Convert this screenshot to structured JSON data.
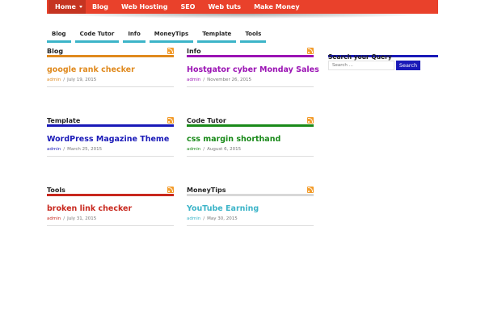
{
  "topnav": {
    "items": [
      {
        "label": "Home",
        "active": true
      },
      {
        "label": "Blog"
      },
      {
        "label": "Web Hosting"
      },
      {
        "label": "SEO"
      },
      {
        "label": "Web tuts"
      },
      {
        "label": "Make Money"
      }
    ]
  },
  "subnav": {
    "items": [
      {
        "label": "Blog"
      },
      {
        "label": "Code Tutor"
      },
      {
        "label": "Info"
      },
      {
        "label": "MoneyTips"
      },
      {
        "label": "Template"
      },
      {
        "label": "Tools"
      }
    ]
  },
  "widgets": [
    {
      "title": "Blog",
      "accent": "#e08a1e",
      "post_title": "google rank checker",
      "post_color": "#e08a1e",
      "author": "admin",
      "date": "July 19, 2015"
    },
    {
      "title": "Info",
      "accent": "#9b14b4",
      "post_title": "Hostgator cyber Monday Sales",
      "post_color": "#9b14b4",
      "author": "admin",
      "date": "November 26, 2015"
    },
    {
      "title": "Template",
      "accent": "#1a1ab8",
      "post_title": "WordPress Magazine Theme",
      "post_color": "#1a1ab8",
      "author": "admin",
      "date": "March 25, 2015"
    },
    {
      "title": "Code Tutor",
      "accent": "#1a8a1a",
      "post_title": "css margin shorthand",
      "post_color": "#1a8a1a",
      "author": "admin",
      "date": "August 6, 2015"
    },
    {
      "title": "Tools",
      "accent": "#c8281e",
      "post_title": "broken link checker",
      "post_color": "#c8281e",
      "author": "admin",
      "date": "July 31, 2015"
    },
    {
      "title": "MoneyTips",
      "accent": "#d8d8d8",
      "post_title": "YouTube Earning",
      "post_color": "#3cb4c8",
      "author": "admin",
      "date": "May 30, 2015"
    }
  ],
  "sidebar": {
    "search_title": "Search your Query",
    "search_placeholder": "Search ...",
    "search_button": "Search"
  },
  "meta_separator": "/",
  "colors": {
    "nav_bg": "#e9412b",
    "nav_active": "#c53421",
    "subnav_underline": "#3cb4c8",
    "search_accent": "#1a1ab8"
  }
}
